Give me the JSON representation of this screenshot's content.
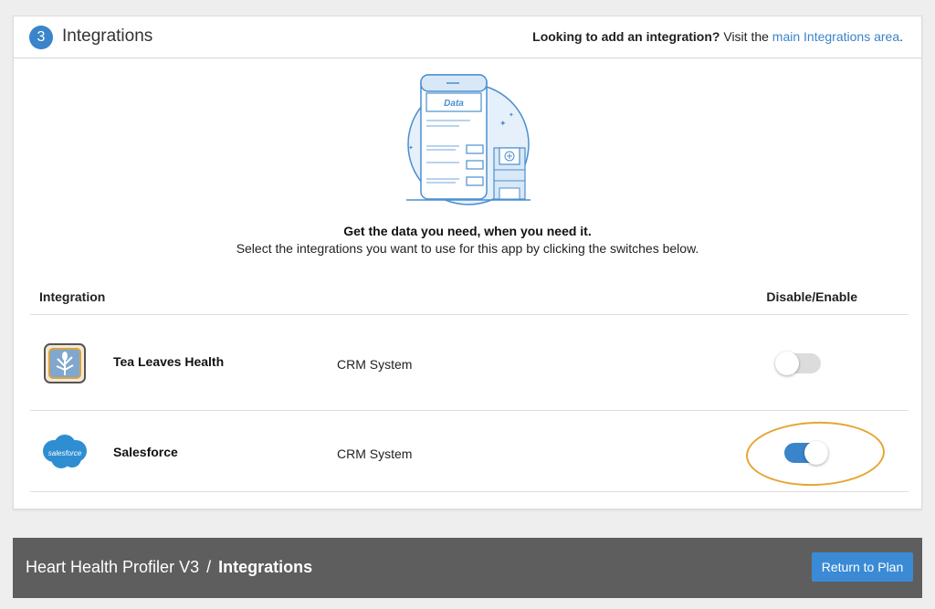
{
  "section": {
    "step": "3",
    "title": "Integrations",
    "note_bold": "Looking to add an integration?",
    "note_text": " Visit the ",
    "note_link": "main Integrations area",
    "note_end": "."
  },
  "illustration": {
    "label": "Data"
  },
  "intro": {
    "headline": "Get the data you need, when you need it.",
    "subtext": "Select the integrations you want to use for this app by clicking the switches below."
  },
  "table": {
    "col_integration": "Integration",
    "col_enable": "Disable/Enable",
    "rows": [
      {
        "name": "Tea Leaves Health",
        "type": "CRM System",
        "enabled": false,
        "logo": "tea-leaves-logo"
      },
      {
        "name": "Salesforce",
        "type": "CRM System",
        "enabled": true,
        "logo": "salesforce-logo",
        "logo_text": "salesforce"
      }
    ]
  },
  "footer": {
    "app_name": "Heart Health Profiler V3",
    "separator": "/",
    "current": "Integrations",
    "return_label": "Return to Plan"
  },
  "colors": {
    "accent": "#3a84c9",
    "highlight": "#e5a533",
    "footer_bg": "#5e5e5e"
  }
}
